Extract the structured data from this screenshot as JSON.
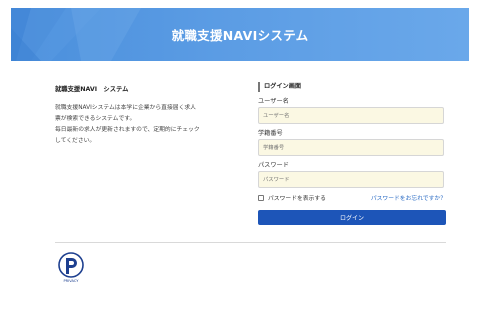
{
  "header": {
    "title": "就職支援NAVIシステム"
  },
  "intro": {
    "heading": "就職支援NAVI　システム",
    "lines": [
      "就職支援NAVIシステムは本学に企業から直接届く求人",
      "票が検索できるシステムです。",
      "毎日最新の求人が更新されますので、定期的にチェック",
      "してください。"
    ]
  },
  "login": {
    "section_title": "ログイン画面",
    "username_label": "ユーザー名",
    "username_placeholder": "ユーザー名",
    "student_id_label": "学籍番号",
    "student_id_placeholder": "学籍番号",
    "password_label": "パスワード",
    "password_placeholder": "パスワード",
    "show_password_label": "パスワードを表示する",
    "forgot_password_link": "パスワードをお忘れですか？",
    "submit_label": "ログイン"
  },
  "footer": {
    "mark_text": "PRIVACY"
  },
  "colors": {
    "banner_start": "#4a8fdc",
    "banner_end": "#6aa8ea",
    "input_bg": "#fbf8e3",
    "button_bg": "#1d55b8",
    "link": "#2a6bc4"
  },
  "icons": {
    "privacy_mark": "privacy-mark-icon",
    "checkbox": "checkbox-icon"
  }
}
